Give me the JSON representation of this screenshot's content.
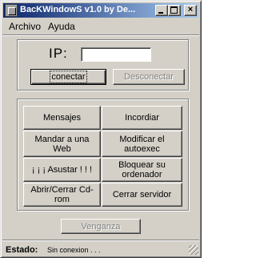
{
  "window": {
    "title": "BacKWindowS v1.0 by De..."
  },
  "menu": {
    "items": [
      "Archivo",
      "Ayuda"
    ]
  },
  "connection": {
    "ip_label": "IP:",
    "ip_value": "",
    "connect_label": "conectar",
    "disconnect_label": "Desconectar"
  },
  "actions": {
    "mensajes": "Mensajes",
    "incordiar": "Incordiar",
    "mandar_web": "Mandar a una Web",
    "modificar_autoexec": "Modificar el autoexec",
    "asustar": "¡ ¡ ¡ Asustar ! ! !",
    "bloquear": "Bloquear su ordenador",
    "cdrom": "Abrir/Cerrar Cd-rom",
    "cerrar_servidor": "Cerrar servidor"
  },
  "venganza_label": "Venganza",
  "status": {
    "label": "Estado:",
    "value": "Sin conexion . . ."
  },
  "colors": {
    "titlebar_start": "#0a246a",
    "titlebar_end": "#a6caf0",
    "face": "#d4d0c8"
  }
}
